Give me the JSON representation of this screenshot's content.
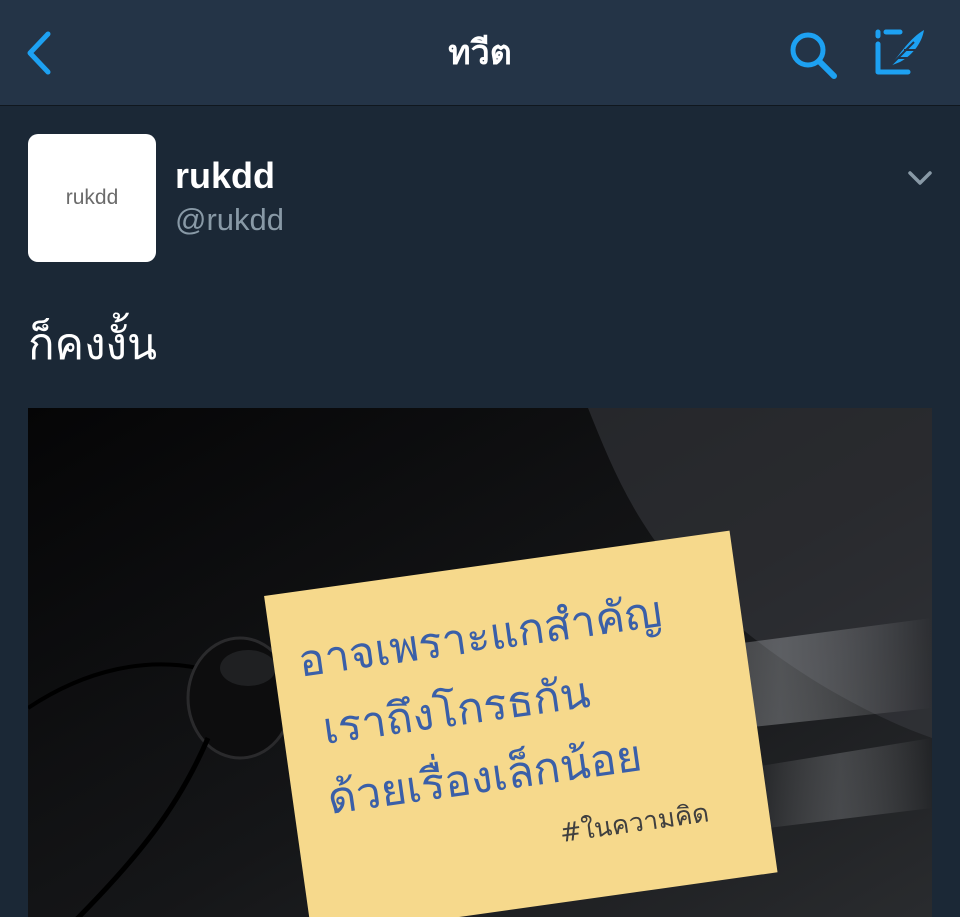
{
  "navbar": {
    "title": "ทวีต",
    "back_icon": "chevron-left-icon",
    "search_icon": "search-icon",
    "compose_icon": "compose-tweet-icon",
    "accent_color": "#1da1f2"
  },
  "tweet": {
    "avatar_text": "rukdd",
    "display_name": "rukdd",
    "handle": "@rukdd",
    "menu_icon": "chevron-down-icon",
    "text": "ก็คงงั้น",
    "media": {
      "note_lines": [
        "อาจเพราะแกสำคัญ",
        "เราถึงโกรธกัน",
        "ด้วยเรื่องเล็กน้อย"
      ],
      "hashtag": "#ในความคิด",
      "note_color": "#f6d98c",
      "ink_color": "#3a5fa8"
    }
  }
}
